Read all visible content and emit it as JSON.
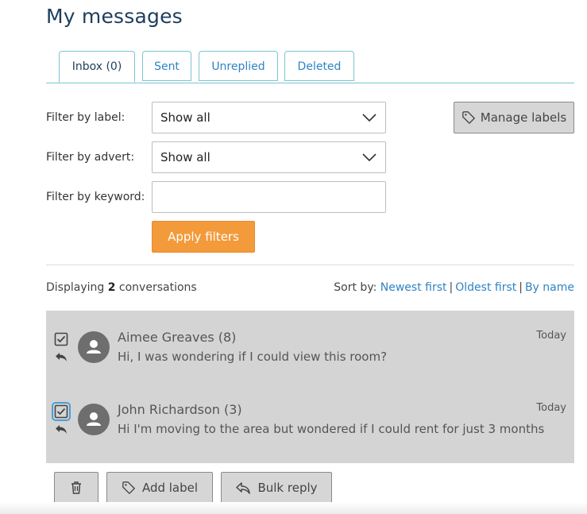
{
  "page": {
    "title": "My messages"
  },
  "tabs": [
    {
      "label": "Inbox (0)",
      "active": true
    },
    {
      "label": "Sent",
      "active": false
    },
    {
      "label": "Unreplied",
      "active": false
    },
    {
      "label": "Deleted",
      "active": false
    }
  ],
  "filters": {
    "label_label": "Filter by label:",
    "label_value": "Show all",
    "advert_label": "Filter by advert:",
    "advert_value": "Show all",
    "keyword_label": "Filter by keyword:",
    "keyword_value": "",
    "apply_label": "Apply filters",
    "manage_labels": "Manage labels"
  },
  "listing": {
    "displaying_prefix": "Displaying",
    "count": "2",
    "displaying_suffix": "conversations",
    "sort_label": "Sort by:",
    "sort_options": [
      "Newest first",
      "Oldest first",
      "By name"
    ]
  },
  "conversations": [
    {
      "name": "Aimee Greaves (8)",
      "preview": "Hi, I was wondering if I could view this room?",
      "date": "Today",
      "checked": true
    },
    {
      "name": "John Richardson (3)",
      "preview": "Hi I'm moving to the area but wondered if I could rent for just 3 months",
      "date": "Today",
      "checked": true
    }
  ],
  "actions": {
    "delete_icon": "trash-icon",
    "add_label": "Add label",
    "bulk_reply": "Bulk reply"
  },
  "colors": {
    "title": "#1d3e5c",
    "link": "#2f84c4",
    "tab_border": "#7cc5d3",
    "apply": "#f39a3a",
    "panel": "#d4d4d4"
  }
}
